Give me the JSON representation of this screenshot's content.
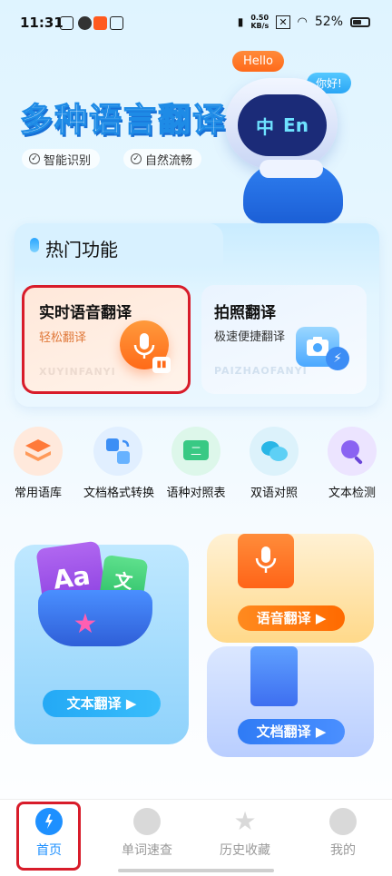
{
  "status_bar": {
    "time": "11:31",
    "net_speed_value": "0.50",
    "net_speed_unit": "KB/s",
    "battery": "52%"
  },
  "hero": {
    "title": "多种语言翻译",
    "features": [
      "智能识别",
      "自然流畅"
    ],
    "bubble_left": "Hello",
    "bubble_right": "你好!",
    "robot_face_left": "中",
    "robot_face_right": "En"
  },
  "hot": {
    "title": "热门功能",
    "cards": [
      {
        "title": "实时语音翻译",
        "subtitle": "轻松翻译",
        "watermark": "XUYINFANYI"
      },
      {
        "title": "拍照翻译",
        "subtitle": "极速便捷翻译",
        "watermark": "PAIZHAOFANYI"
      }
    ]
  },
  "tools": [
    {
      "label": "常用语库",
      "icon": "stack-layers-icon"
    },
    {
      "label": "文档格式转换",
      "icon": "document-convert-icon"
    },
    {
      "label": "语种对照表",
      "icon": "language-table-icon"
    },
    {
      "label": "双语对照",
      "icon": "chat-bubbles-icon"
    },
    {
      "label": "文本检测",
      "icon": "magnifier-icon"
    }
  ],
  "features": {
    "text_translate": "文本翻译",
    "voice_translate": "语音翻译",
    "doc_translate": "文档翻译",
    "aa_label": "Aa",
    "wen_label": "文"
  },
  "nav": {
    "items": [
      {
        "label": "首页",
        "active": true
      },
      {
        "label": "单词速查",
        "active": false
      },
      {
        "label": "历史收藏",
        "active": false
      },
      {
        "label": "我的",
        "active": false
      }
    ]
  },
  "colors": {
    "accent_blue": "#1e90ff",
    "highlight_red": "#d81c2a",
    "orange": "#ff7a1f"
  }
}
